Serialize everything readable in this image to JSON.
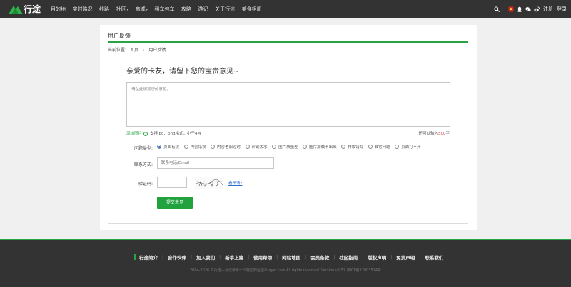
{
  "nav": {
    "logo_text": "行途",
    "links": [
      "目的地",
      "实时路况",
      "线路",
      "社区",
      "商城",
      "租车包车",
      "攻略",
      "游记",
      "关于行途",
      "美食相册"
    ],
    "dropdown_links": [
      "社区",
      "商城"
    ],
    "register": "注册",
    "login": "登录",
    "divider": "|"
  },
  "page": {
    "title": "用户反馈",
    "breadcrumb_prefix": "当前位置:",
    "breadcrumb_home": "首页",
    "breadcrumb_current": "用户反馈"
  },
  "form": {
    "heading": "亲爱的卡友，请留下您的宝贵意见~",
    "textarea_placeholder": "请在此填写您的意见。",
    "upload_link": "添加图片",
    "upload_help_icon": "?",
    "upload_hint": "支持jpg、png格式，小于4M",
    "limit_prefix": "还可以输入",
    "limit_count": "500",
    "limit_suffix": "字",
    "type_label": "问题类型:",
    "types": [
      "页面有误",
      "内容错误",
      "内容老旧过时",
      "评论太水",
      "图片质量差",
      "图片加载不出来",
      "排版错乱",
      "其它问题",
      "页面打不开"
    ],
    "selected_type": "页面有误",
    "contact_label": "联系方式:",
    "contact_placeholder": "联系电话/Email",
    "captcha_label": "验证码:",
    "captcha_refresh": "看不清?",
    "submit_label": "提交意见"
  },
  "footer": {
    "links": [
      "行途简介",
      "合作伙伴",
      "加入我们",
      "新手上路",
      "使用帮助",
      "网站地图",
      "会员条款",
      "社区指南",
      "版权声明",
      "免责声明",
      "联系我们"
    ],
    "separator": "|",
    "copyright": "2004-2026 ©行途—为记录每一个邂逅的足迹® qyer.com All rights reserved. Version v5.57 京ICP备12003524号"
  },
  "colors": {
    "accent": "#27a545",
    "nav_bg": "#333333",
    "selected_radio": "#2a6fd1",
    "limit_number": "#e4393c"
  },
  "icons": [
    "search-icon",
    "flag-icon",
    "qq-icon",
    "wechat-icon",
    "weibo-icon"
  ]
}
